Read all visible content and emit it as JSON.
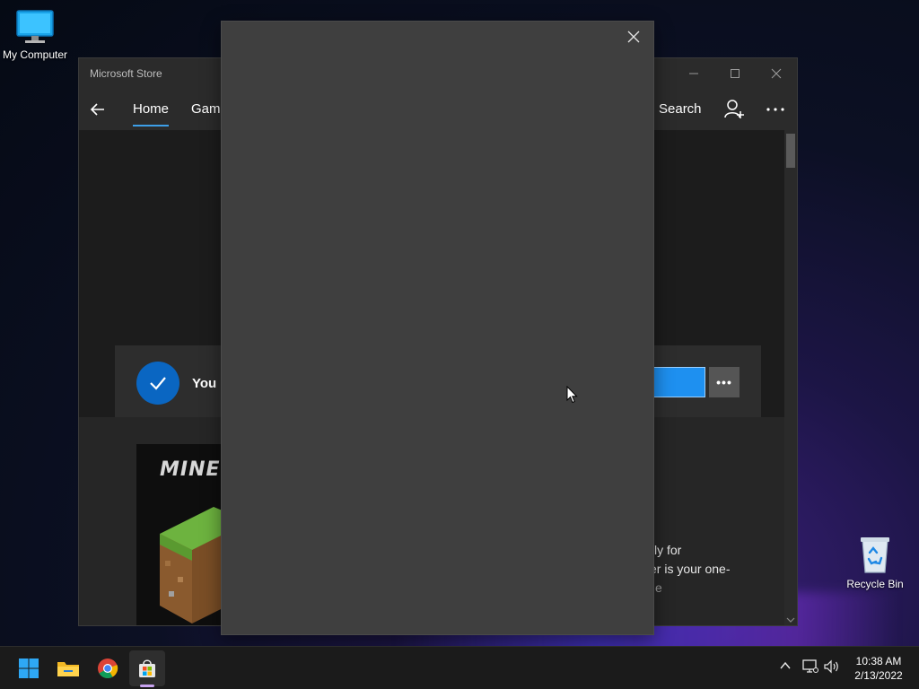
{
  "desktop": {
    "icons": [
      {
        "label": "My Computer",
        "icon": "monitor-icon"
      },
      {
        "label": "Recycle Bin",
        "icon": "recycle-bin-icon"
      }
    ]
  },
  "store": {
    "title": "Microsoft Store",
    "nav": {
      "home": "Home",
      "gaming": "Gami",
      "search": "Search"
    },
    "banner": {
      "text": "You d"
    },
    "game_logo": "MINE",
    "description": [
      "cially for",
      "er is your one-",
      "e"
    ]
  },
  "taskbar": {
    "apps": [
      "start-icon",
      "file-explorer-icon",
      "chrome-icon",
      "microsoft-store-icon"
    ],
    "clock": {
      "time": "10:38 AM",
      "date": "2/13/2022"
    }
  },
  "colors": {
    "accent": "#0a66c2",
    "primary_button": "#1e90f0",
    "dialog_bg": "#3f3f3f"
  }
}
